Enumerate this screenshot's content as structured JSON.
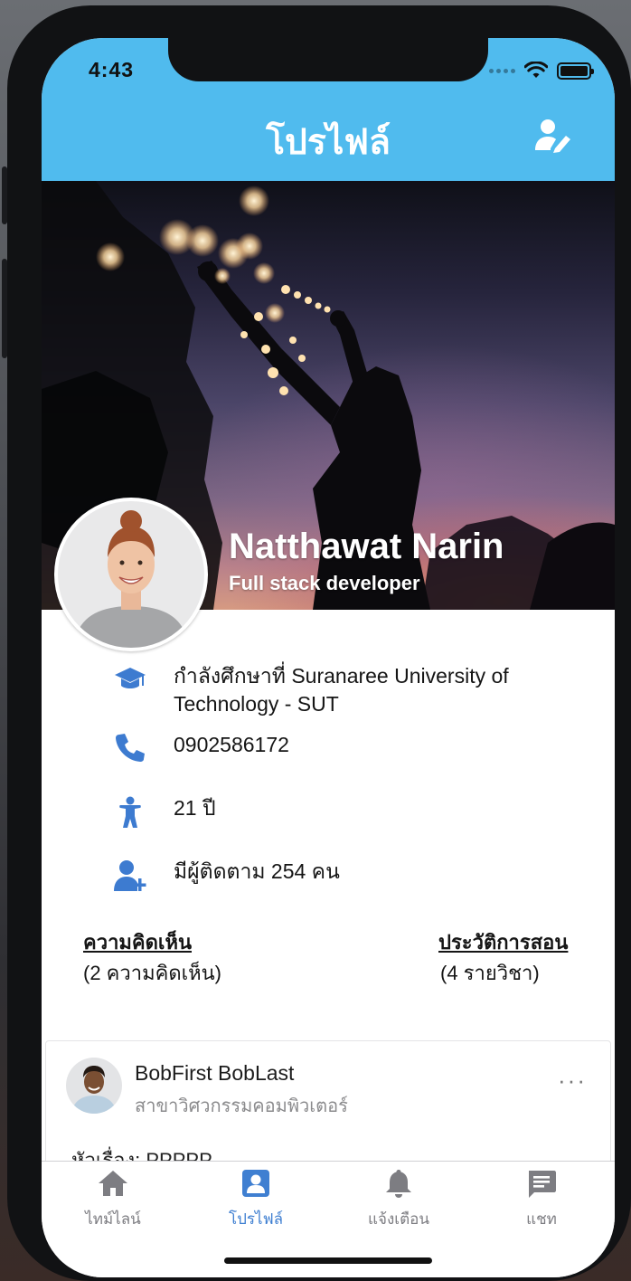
{
  "status_bar": {
    "time": "4:43"
  },
  "header": {
    "title": "โปรไฟล์",
    "edit_icon": "user-edit-icon"
  },
  "profile": {
    "name": "Natthawat Narin",
    "role": "Full stack developer"
  },
  "info": [
    {
      "icon": "graduation-cap-icon",
      "text": "กำลังศึกษาที่ Suranaree University of Technology - SUT"
    },
    {
      "icon": "phone-icon",
      "text": "0902586172"
    },
    {
      "icon": "person-icon",
      "text": "21 ปี"
    },
    {
      "icon": "user-plus-icon",
      "text": "มีผู้ติดตาม 254 คน"
    }
  ],
  "stats": {
    "comments": {
      "title": "ความคิดเห็น",
      "sub": "(2 ความคิดเห็น)"
    },
    "teaching": {
      "title": "ประวัติการสอน",
      "sub": "(4 รายวิชา)"
    }
  },
  "post": {
    "author": "BobFirst BobLast",
    "department": "สาขาวิศวกรรมคอมพิวเตอร์",
    "more": "···",
    "subject": "หัวเรื่อง: PPPPP"
  },
  "tabs": [
    {
      "label": "ไทม์ไลน์",
      "icon": "home-icon",
      "active": false
    },
    {
      "label": "โปรไฟล์",
      "icon": "profile-icon",
      "active": true
    },
    {
      "label": "แจ้งเตือน",
      "icon": "bell-icon",
      "active": false
    },
    {
      "label": "แชท",
      "icon": "chat-icon",
      "active": false
    }
  ],
  "colors": {
    "header": "#50bbee",
    "accent": "#3f7fd1",
    "icon": "#3d7bd0",
    "inactive": "#7d7d82"
  }
}
